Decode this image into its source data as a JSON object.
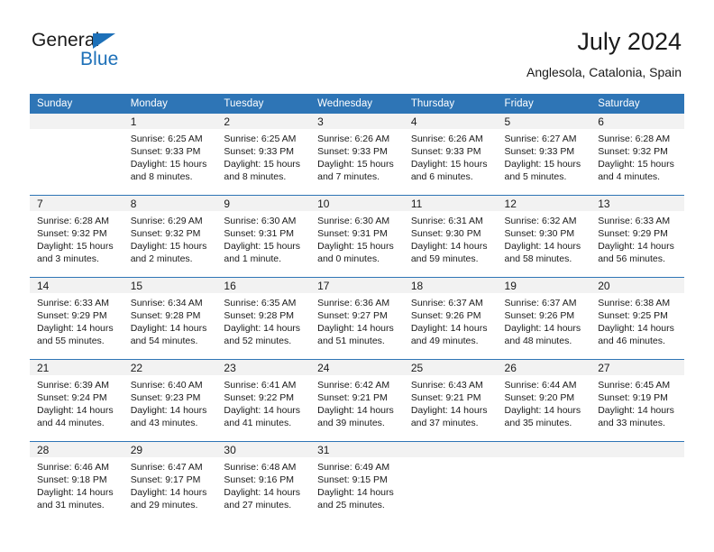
{
  "brand": {
    "name_part1": "General",
    "name_part2": "Blue",
    "accent_color": "#1d70b8"
  },
  "header": {
    "title": "July 2024",
    "subtitle": "Anglesola, Catalonia, Spain"
  },
  "theme": {
    "header_row_bg": "#2e75b6",
    "daynum_band_bg": "#f2f2f2",
    "separator_color": "#2e75b6",
    "text_color": "#1a1a1a"
  },
  "weekday_headers": [
    "Sunday",
    "Monday",
    "Tuesday",
    "Wednesday",
    "Thursday",
    "Friday",
    "Saturday"
  ],
  "labels": {
    "sunrise_prefix": "Sunrise:",
    "sunset_prefix": "Sunset:",
    "daylight_prefix": "Daylight:"
  },
  "weeks": [
    [
      {
        "day": "",
        "empty": true,
        "line1": "",
        "line2": "",
        "line3": "",
        "line4": ""
      },
      {
        "day": "1",
        "empty": false,
        "line1": "Sunrise: 6:25 AM",
        "line2": "Sunset: 9:33 PM",
        "line3": "Daylight: 15 hours",
        "line4": "and 8 minutes."
      },
      {
        "day": "2",
        "empty": false,
        "line1": "Sunrise: 6:25 AM",
        "line2": "Sunset: 9:33 PM",
        "line3": "Daylight: 15 hours",
        "line4": "and 8 minutes."
      },
      {
        "day": "3",
        "empty": false,
        "line1": "Sunrise: 6:26 AM",
        "line2": "Sunset: 9:33 PM",
        "line3": "Daylight: 15 hours",
        "line4": "and 7 minutes."
      },
      {
        "day": "4",
        "empty": false,
        "line1": "Sunrise: 6:26 AM",
        "line2": "Sunset: 9:33 PM",
        "line3": "Daylight: 15 hours",
        "line4": "and 6 minutes."
      },
      {
        "day": "5",
        "empty": false,
        "line1": "Sunrise: 6:27 AM",
        "line2": "Sunset: 9:33 PM",
        "line3": "Daylight: 15 hours",
        "line4": "and 5 minutes."
      },
      {
        "day": "6",
        "empty": false,
        "line1": "Sunrise: 6:28 AM",
        "line2": "Sunset: 9:32 PM",
        "line3": "Daylight: 15 hours",
        "line4": "and 4 minutes."
      }
    ],
    [
      {
        "day": "7",
        "empty": false,
        "line1": "Sunrise: 6:28 AM",
        "line2": "Sunset: 9:32 PM",
        "line3": "Daylight: 15 hours",
        "line4": "and 3 minutes."
      },
      {
        "day": "8",
        "empty": false,
        "line1": "Sunrise: 6:29 AM",
        "line2": "Sunset: 9:32 PM",
        "line3": "Daylight: 15 hours",
        "line4": "and 2 minutes."
      },
      {
        "day": "9",
        "empty": false,
        "line1": "Sunrise: 6:30 AM",
        "line2": "Sunset: 9:31 PM",
        "line3": "Daylight: 15 hours",
        "line4": "and 1 minute."
      },
      {
        "day": "10",
        "empty": false,
        "line1": "Sunrise: 6:30 AM",
        "line2": "Sunset: 9:31 PM",
        "line3": "Daylight: 15 hours",
        "line4": "and 0 minutes."
      },
      {
        "day": "11",
        "empty": false,
        "line1": "Sunrise: 6:31 AM",
        "line2": "Sunset: 9:30 PM",
        "line3": "Daylight: 14 hours",
        "line4": "and 59 minutes."
      },
      {
        "day": "12",
        "empty": false,
        "line1": "Sunrise: 6:32 AM",
        "line2": "Sunset: 9:30 PM",
        "line3": "Daylight: 14 hours",
        "line4": "and 58 minutes."
      },
      {
        "day": "13",
        "empty": false,
        "line1": "Sunrise: 6:33 AM",
        "line2": "Sunset: 9:29 PM",
        "line3": "Daylight: 14 hours",
        "line4": "and 56 minutes."
      }
    ],
    [
      {
        "day": "14",
        "empty": false,
        "line1": "Sunrise: 6:33 AM",
        "line2": "Sunset: 9:29 PM",
        "line3": "Daylight: 14 hours",
        "line4": "and 55 minutes."
      },
      {
        "day": "15",
        "empty": false,
        "line1": "Sunrise: 6:34 AM",
        "line2": "Sunset: 9:28 PM",
        "line3": "Daylight: 14 hours",
        "line4": "and 54 minutes."
      },
      {
        "day": "16",
        "empty": false,
        "line1": "Sunrise: 6:35 AM",
        "line2": "Sunset: 9:28 PM",
        "line3": "Daylight: 14 hours",
        "line4": "and 52 minutes."
      },
      {
        "day": "17",
        "empty": false,
        "line1": "Sunrise: 6:36 AM",
        "line2": "Sunset: 9:27 PM",
        "line3": "Daylight: 14 hours",
        "line4": "and 51 minutes."
      },
      {
        "day": "18",
        "empty": false,
        "line1": "Sunrise: 6:37 AM",
        "line2": "Sunset: 9:26 PM",
        "line3": "Daylight: 14 hours",
        "line4": "and 49 minutes."
      },
      {
        "day": "19",
        "empty": false,
        "line1": "Sunrise: 6:37 AM",
        "line2": "Sunset: 9:26 PM",
        "line3": "Daylight: 14 hours",
        "line4": "and 48 minutes."
      },
      {
        "day": "20",
        "empty": false,
        "line1": "Sunrise: 6:38 AM",
        "line2": "Sunset: 9:25 PM",
        "line3": "Daylight: 14 hours",
        "line4": "and 46 minutes."
      }
    ],
    [
      {
        "day": "21",
        "empty": false,
        "line1": "Sunrise: 6:39 AM",
        "line2": "Sunset: 9:24 PM",
        "line3": "Daylight: 14 hours",
        "line4": "and 44 minutes."
      },
      {
        "day": "22",
        "empty": false,
        "line1": "Sunrise: 6:40 AM",
        "line2": "Sunset: 9:23 PM",
        "line3": "Daylight: 14 hours",
        "line4": "and 43 minutes."
      },
      {
        "day": "23",
        "empty": false,
        "line1": "Sunrise: 6:41 AM",
        "line2": "Sunset: 9:22 PM",
        "line3": "Daylight: 14 hours",
        "line4": "and 41 minutes."
      },
      {
        "day": "24",
        "empty": false,
        "line1": "Sunrise: 6:42 AM",
        "line2": "Sunset: 9:21 PM",
        "line3": "Daylight: 14 hours",
        "line4": "and 39 minutes."
      },
      {
        "day": "25",
        "empty": false,
        "line1": "Sunrise: 6:43 AM",
        "line2": "Sunset: 9:21 PM",
        "line3": "Daylight: 14 hours",
        "line4": "and 37 minutes."
      },
      {
        "day": "26",
        "empty": false,
        "line1": "Sunrise: 6:44 AM",
        "line2": "Sunset: 9:20 PM",
        "line3": "Daylight: 14 hours",
        "line4": "and 35 minutes."
      },
      {
        "day": "27",
        "empty": false,
        "line1": "Sunrise: 6:45 AM",
        "line2": "Sunset: 9:19 PM",
        "line3": "Daylight: 14 hours",
        "line4": "and 33 minutes."
      }
    ],
    [
      {
        "day": "28",
        "empty": false,
        "line1": "Sunrise: 6:46 AM",
        "line2": "Sunset: 9:18 PM",
        "line3": "Daylight: 14 hours",
        "line4": "and 31 minutes."
      },
      {
        "day": "29",
        "empty": false,
        "line1": "Sunrise: 6:47 AM",
        "line2": "Sunset: 9:17 PM",
        "line3": "Daylight: 14 hours",
        "line4": "and 29 minutes."
      },
      {
        "day": "30",
        "empty": false,
        "line1": "Sunrise: 6:48 AM",
        "line2": "Sunset: 9:16 PM",
        "line3": "Daylight: 14 hours",
        "line4": "and 27 minutes."
      },
      {
        "day": "31",
        "empty": false,
        "line1": "Sunrise: 6:49 AM",
        "line2": "Sunset: 9:15 PM",
        "line3": "Daylight: 14 hours",
        "line4": "and 25 minutes."
      },
      {
        "day": "",
        "empty": true,
        "line1": "",
        "line2": "",
        "line3": "",
        "line4": ""
      },
      {
        "day": "",
        "empty": true,
        "line1": "",
        "line2": "",
        "line3": "",
        "line4": ""
      },
      {
        "day": "",
        "empty": true,
        "line1": "",
        "line2": "",
        "line3": "",
        "line4": ""
      }
    ]
  ]
}
